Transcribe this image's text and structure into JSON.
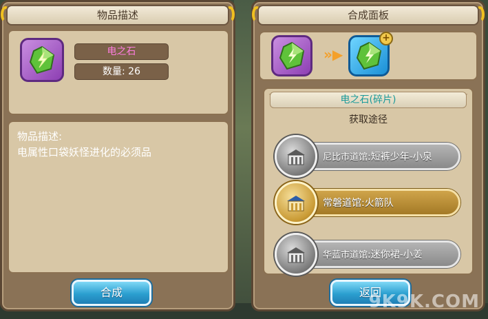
{
  "left_panel": {
    "title": "物品描述",
    "item_name": "电之石",
    "quantity_text": "数量: 26",
    "description_heading": "物品描述:",
    "description_body": "电属性口袋妖怪进化的必须品",
    "button_label": "合成",
    "item_icon": "thunder-stone-icon"
  },
  "right_panel": {
    "title": "合成面板",
    "source_icon": "thunder-stone-icon",
    "target_icon": "thunder-stone-fragment-icon",
    "target_badge": "+",
    "fragment_name": "电之石(碎片)",
    "routes_heading": "获取途径",
    "routes": [
      {
        "gym": "尼比市道馆",
        "detail": ":短裤少年-小泉",
        "style": "grey"
      },
      {
        "gym": "常磐道馆",
        "detail": ":火箭队",
        "style": "gold"
      },
      {
        "gym": "华蓝市道馆",
        "detail": ":迷你裙-小姜",
        "style": "grey"
      }
    ],
    "button_label": "返回"
  },
  "watermark": "9K9K.COM",
  "colors": {
    "panel": "#8a7256",
    "inner": "#d8c7a6",
    "accent_pink": "#ff7de0",
    "accent_teal": "#1a9a9a",
    "button_blue": "#2b9fd0",
    "curl_gold": "#f0c020"
  }
}
